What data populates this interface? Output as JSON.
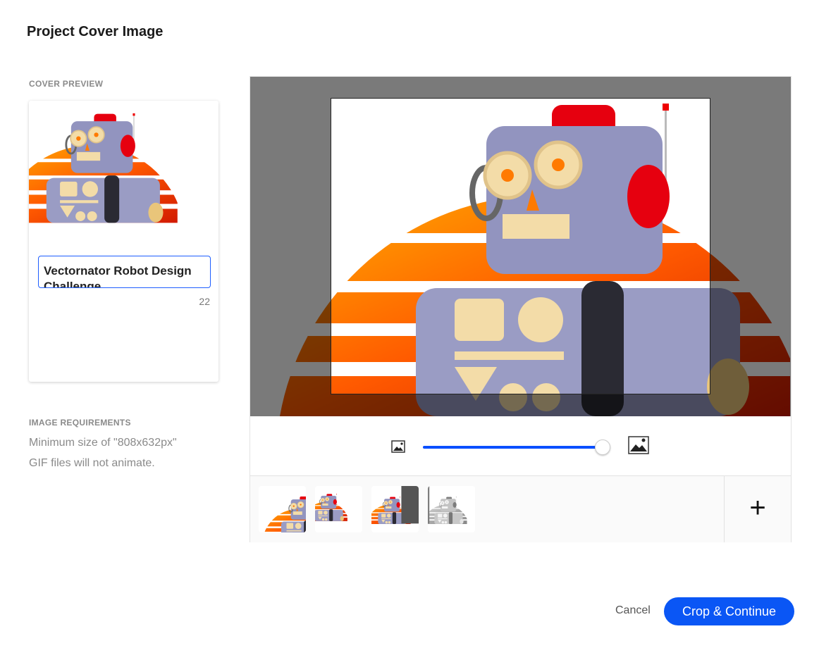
{
  "dialog": {
    "title": "Project Cover Image"
  },
  "preview": {
    "label": "COVER PREVIEW",
    "name_value": "Vectornator Robot Design Challenge",
    "char_count": "22"
  },
  "requirements": {
    "label": "IMAGE REQUIREMENTS",
    "lines": [
      "Minimum size of \"808x632px\"",
      "GIF files will not animate."
    ]
  },
  "editor": {
    "zoom_level_percent": 100,
    "zoom_out_icon": "small-image-icon",
    "zoom_in_icon": "large-image-icon",
    "add_label": "+",
    "thumbnails": [
      "robot-sunset",
      "robot-closeup",
      "robot-app-ui",
      "robot-wireframe"
    ]
  },
  "footer": {
    "cancel": "Cancel",
    "confirm": "Crop & Continue"
  },
  "colors": {
    "accent": "#0a56f5",
    "robot": "#9a9cc4",
    "sun": "#ff6a00"
  }
}
